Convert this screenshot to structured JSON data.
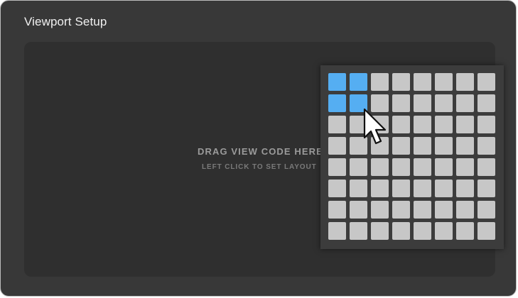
{
  "dialog": {
    "title": "Viewport Setup"
  },
  "drop_zone": {
    "title": "DRAG VIEW CODE HERE",
    "subtitle": "LEFT CLICK TO SET LAYOUT"
  },
  "layout_grid": {
    "columns": 8,
    "rows": 8,
    "selected_columns": 2,
    "selected_rows": 2
  },
  "colors": {
    "window_bg": "#383838",
    "drop_zone_bg": "#2f2f2f",
    "cell": "#c7c7c7",
    "cell_selected": "#55aef2"
  },
  "icons": {
    "cursor": "arrow-cursor-icon"
  }
}
